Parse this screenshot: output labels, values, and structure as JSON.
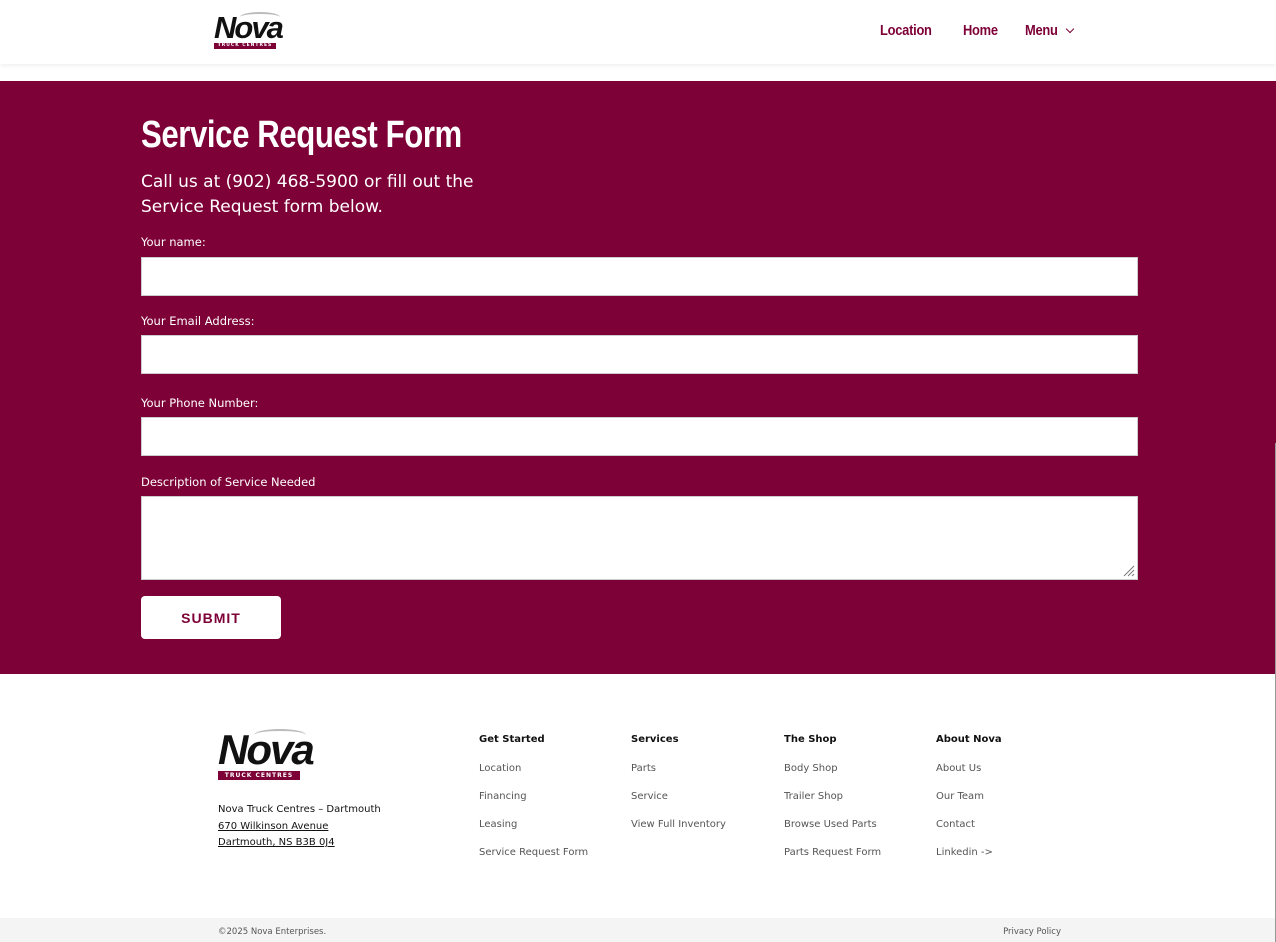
{
  "brand": {
    "name": "Nova",
    "tagline": "TRUCK CENTRES",
    "accent_color": "#7d0036"
  },
  "nav": {
    "items": [
      "Location",
      "Home"
    ],
    "menu_label": "Menu"
  },
  "form": {
    "title": "Service Request Form",
    "intro": "Call us at (902) 468-5900 or fill out the Service Request form below.",
    "fields": {
      "name_label": "Your name:",
      "email_label": "Your Email Address:",
      "phone_label": "Your Phone Number:",
      "description_label": "Description of Service Needed"
    },
    "values": {
      "name": "",
      "email": "",
      "phone": "",
      "description": ""
    },
    "submit_label": "SUBMIT"
  },
  "footer": {
    "address": {
      "line1": "Nova Truck Centres – Dartmouth",
      "line2": "670 Wilkinson Avenue",
      "line3": "Dartmouth, NS B3B 0J4"
    },
    "columns": [
      {
        "heading": "Get Started",
        "links": [
          "Location",
          "Financing",
          "Leasing",
          "Service Request Form"
        ]
      },
      {
        "heading": "Services",
        "links": [
          "Parts",
          "Service",
          "View Full Inventory"
        ]
      },
      {
        "heading": "The Shop",
        "links": [
          "Body Shop",
          "Trailer Shop",
          "Browse Used Parts",
          "Parts Request Form"
        ]
      },
      {
        "heading": "About Nova",
        "links": [
          "About Us",
          "Our Team",
          "Contact",
          "Linkedin ->"
        ]
      }
    ],
    "copyright": "©2025 Nova Enterprises.",
    "privacy": "Privacy Policy"
  }
}
